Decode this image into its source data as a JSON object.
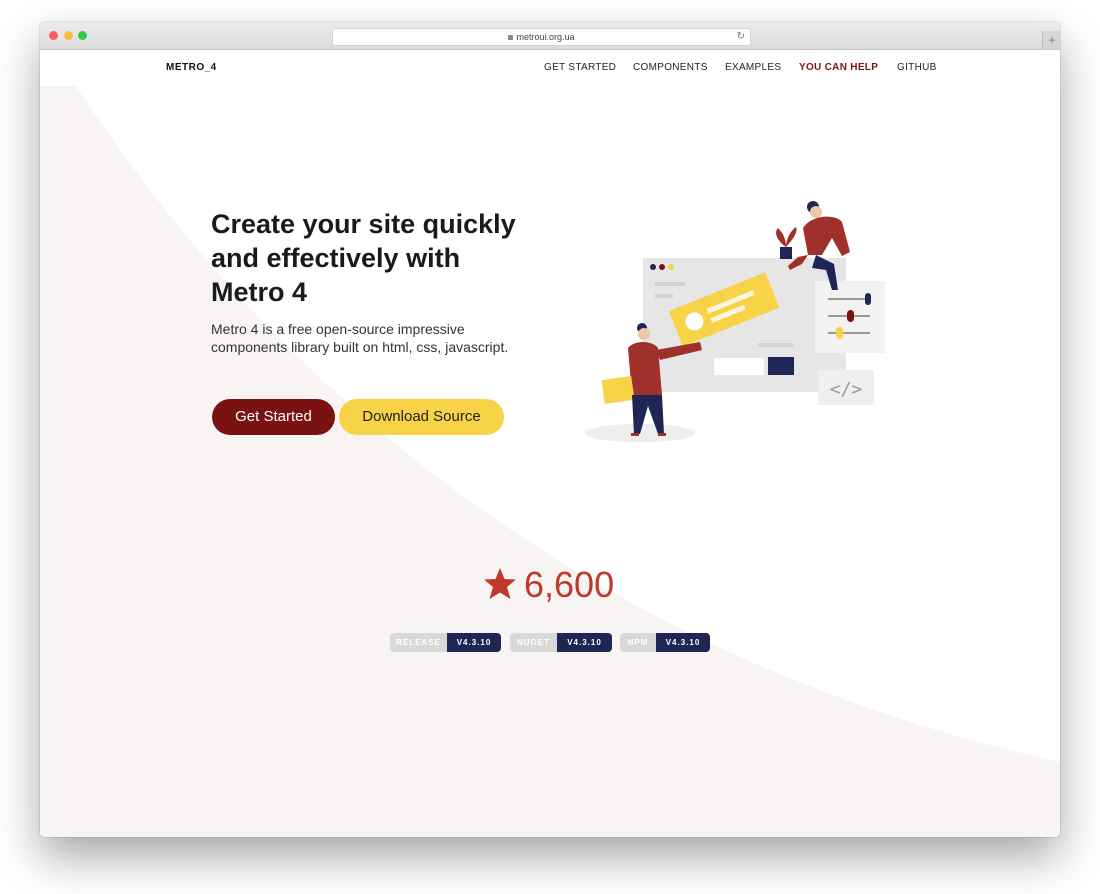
{
  "browser": {
    "url": "metroui.org.ua"
  },
  "nav": {
    "brand": "METRO_4",
    "links": [
      {
        "label": "GET STARTED"
      },
      {
        "label": "COMPONENTS"
      },
      {
        "label": "EXAMPLES"
      },
      {
        "label": "YOU CAN HELP"
      },
      {
        "label": "GITHUB"
      }
    ]
  },
  "hero": {
    "headline": "Create your site quickly and effectively with Metro 4",
    "description": "Metro 4 is a free open-source impressive components library built on html, css, javascript.",
    "primary_button": "Get Started",
    "secondary_button": "Download Source"
  },
  "stats": {
    "stars": "6,600"
  },
  "badges": [
    {
      "label": "RELEASE",
      "value": "V4.3.10"
    },
    {
      "label": "NUGET",
      "value": "V4.3.10"
    },
    {
      "label": "NPM",
      "value": "V4.3.10"
    }
  ],
  "colors": {
    "brand_red": "#7a1212",
    "accent_yellow": "#f8d347",
    "star_red": "#c1392b",
    "badge_navy": "#1e2655",
    "background_tint": "#f8f4f4"
  }
}
